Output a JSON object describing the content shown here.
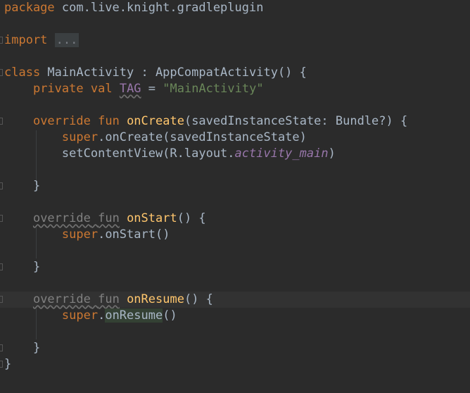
{
  "editor": {
    "language": "kotlin",
    "lines": {
      "l1": {
        "kw": "package",
        "rest": " com.live.knight.gradleplugin"
      },
      "l2": {
        "kw": "import",
        "folded": "..."
      },
      "l3": {
        "kw": "class",
        "rest": " MainActivity : AppCompatActivity() {"
      },
      "l4": {
        "kw1": "private",
        "kw2": "val",
        "name": "TAG",
        "eq": " = ",
        "str": "\"MainActivity\""
      },
      "l5": {
        "kw1": "override",
        "kw2": "fun",
        "fn": "onCreate",
        "rest": "(savedInstanceState: Bundle?) {"
      },
      "l6": {
        "kw": "super",
        "rest": ".onCreate(savedInstanceState)"
      },
      "l7": {
        "pre": "setContentView(R.layout.",
        "prop": "activity_main",
        "post": ")"
      },
      "l8": {
        "brace": "}"
      },
      "l9": {
        "kw1": "override",
        "kw2": "fun",
        "fn": "onStart",
        "rest": "() {"
      },
      "l10": {
        "kw": "super",
        "rest": ".onStart()"
      },
      "l11": {
        "brace": "}"
      },
      "l12": {
        "kw1": "override",
        "kw2": "fun",
        "fn": "onResume",
        "rest": "() {"
      },
      "l13": {
        "kw": "super",
        "dot": ".",
        "hl": "onResume",
        "rest": "()"
      },
      "l14": {
        "brace": "}"
      },
      "l15": {
        "brace": "}"
      }
    }
  },
  "colors": {
    "background": "#2b2b2b",
    "keyword": "#cc7832",
    "string": "#6a8759",
    "function": "#ffc66d",
    "property": "#9876aa",
    "text": "#a9b7c6",
    "current_line": "#323232"
  }
}
